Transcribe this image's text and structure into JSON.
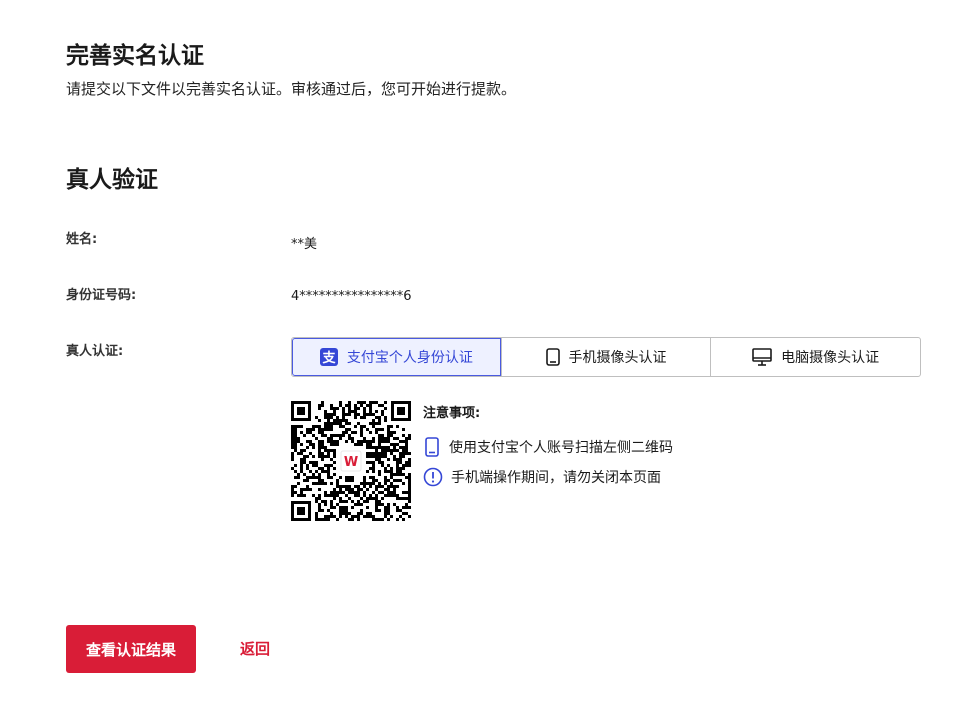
{
  "header": {
    "title": "完善实名认证",
    "subtitle": "请提交以下文件以完善实名认证。审核通过后，您可开始进行提款。"
  },
  "section": {
    "title": "真人验证"
  },
  "fields": {
    "name_label": "姓名:",
    "name_value": "**美",
    "id_label": "身份证号码:",
    "id_value": "4****************6",
    "verify_label": "真人认证:"
  },
  "tabs": [
    {
      "label": "支付宝个人身份认证",
      "icon": "alipay-icon",
      "active": true
    },
    {
      "label": "手机摄像头认证",
      "icon": "phone-icon",
      "active": false
    },
    {
      "label": "电脑摄像头认证",
      "icon": "monitor-icon",
      "active": false
    }
  ],
  "qr": {
    "logo_text": "W"
  },
  "notes": {
    "title": "注意事项:",
    "items": [
      {
        "icon": "phone-icon",
        "text": "使用支付宝个人账号扫描左侧二维码"
      },
      {
        "icon": "alert-icon",
        "text": "手机端操作期间，请勿关闭本页面"
      }
    ]
  },
  "actions": {
    "primary_label": "查看认证结果",
    "back_label": "返回"
  },
  "colors": {
    "accent": "#d91d37",
    "tab_active": "#3547d6",
    "icon_blue": "#3547d6"
  }
}
